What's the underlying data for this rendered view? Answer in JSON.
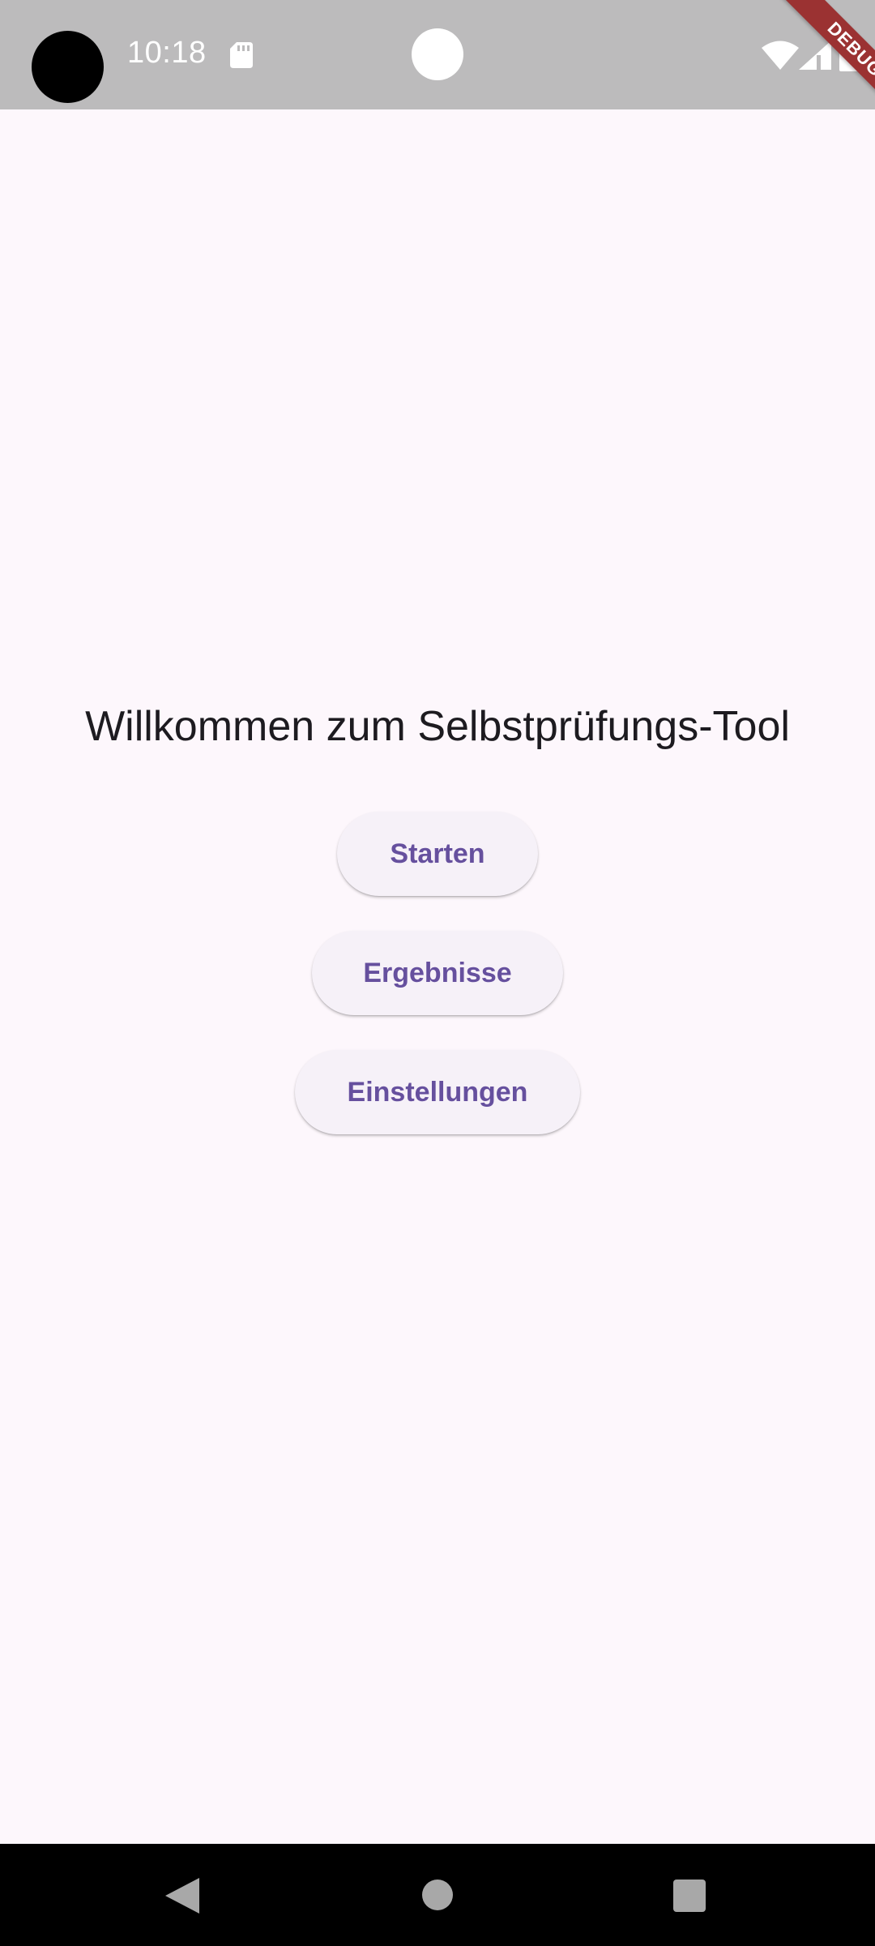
{
  "status_bar": {
    "time": "10:18",
    "icons": [
      "sd-card-icon",
      "wifi-icon",
      "cell-signal-icon",
      "battery-icon"
    ]
  },
  "debug_banner": {
    "label": "DEBUG"
  },
  "main": {
    "title": "Willkommen zum Selbstprüfungs-Tool",
    "buttons": [
      {
        "label": "Starten"
      },
      {
        "label": "Ergebnisse"
      },
      {
        "label": "Einstellungen"
      }
    ]
  },
  "nav_bar": {
    "icons": [
      "back-icon",
      "home-icon",
      "recent-apps-icon"
    ]
  },
  "colors": {
    "background": "#fdf7fc",
    "status_bar": "#bcbbbc",
    "button_background": "#f6f1f8",
    "button_text": "#66509e",
    "title_text": "#1d1b20",
    "debug_banner": "#9b3232"
  }
}
